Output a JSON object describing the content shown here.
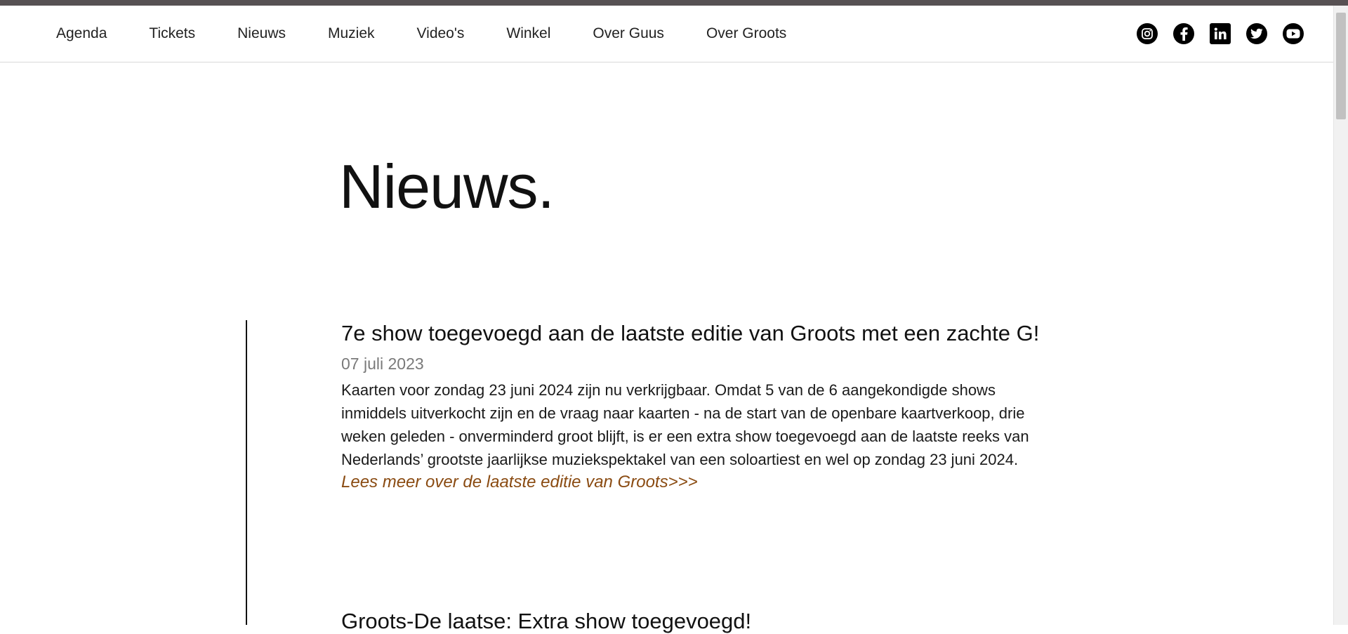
{
  "nav": {
    "items": [
      {
        "label": "Agenda"
      },
      {
        "label": "Tickets"
      },
      {
        "label": "Nieuws"
      },
      {
        "label": "Muziek"
      },
      {
        "label": "Video's"
      },
      {
        "label": "Winkel"
      },
      {
        "label": "Over Guus"
      },
      {
        "label": "Over Groots"
      }
    ]
  },
  "social": {
    "icons": [
      "instagram-icon",
      "facebook-icon",
      "linkedin-icon",
      "twitter-icon",
      "youtube-icon"
    ]
  },
  "page": {
    "title": "Nieuws."
  },
  "articles": [
    {
      "title": "7e show toegevoegd aan de laatste editie van Groots met een zachte G!",
      "date": "07 juli 2023",
      "body": "Kaarten voor zondag 23 juni 2024 zijn nu verkrijgbaar. Omdat 5 van de 6 aangekondigde shows inmiddels uitverkocht zijn en de vraag naar kaarten - na de start van de openbare kaartverkoop, drie weken geleden - onverminderd groot blijft, is er een extra show toegevoegd aan de laatste reeks van Nederlands’ grootste jaarlijkse muziekspektakel van een soloartiest en wel op zondag 23 juni 2024.",
      "link": "Lees meer over de laatste editie van Groots>>>"
    },
    {
      "title": "Groots-De laatse: Extra show toegevoegd!"
    }
  ],
  "colors": {
    "topbar": "#575153",
    "link": "#8a4b12",
    "date": "#7a7a7a"
  }
}
